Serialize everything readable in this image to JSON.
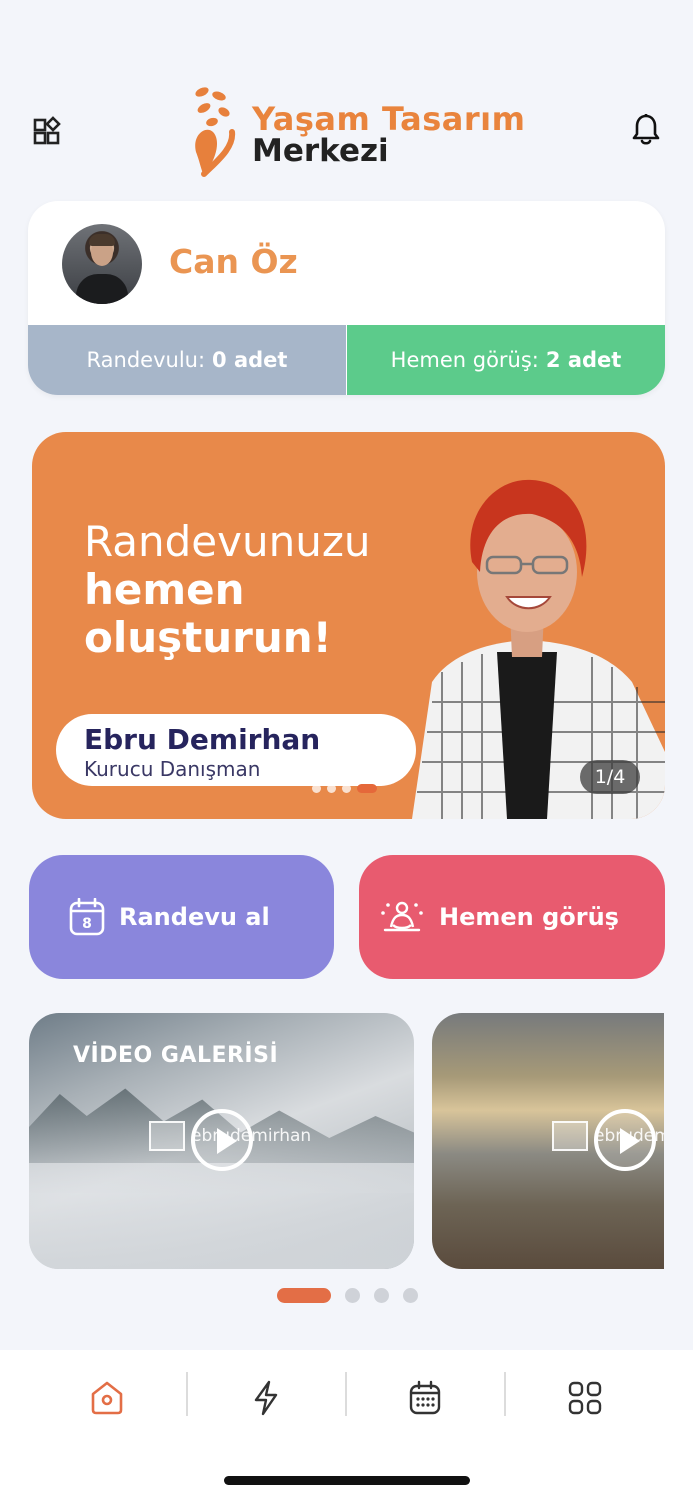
{
  "header": {
    "brand_line1": "Yaşam Tasarım",
    "brand_line2": "Merkezi",
    "menu_icon": "grid-menu-icon",
    "notification_icon": "bell-icon"
  },
  "profile": {
    "name": "Can Öz",
    "stats": {
      "appointment_label": "Randevulu:",
      "appointment_value": "0 adet",
      "instant_label": "Hemen görüş:",
      "instant_value": "2 adet"
    }
  },
  "banner": {
    "title_light": "Randevunuzu",
    "title_bold_1": "hemen",
    "title_bold_2": "oluşturun!",
    "person_name": "Ebru Demirhan",
    "person_role": "Kurucu Danışman",
    "counter": "1/4",
    "dot_count": 4,
    "active_dot": 3
  },
  "actions": {
    "appointment_label": "Randevu al",
    "appointment_icon": "calendar-icon",
    "appointment_icon_text": "8",
    "instant_label": "Hemen görüş",
    "instant_icon": "meditation-icon"
  },
  "gallery": {
    "title": "VİDEO GALERİSİ",
    "watermark": "ebrudemirhan",
    "videos": [
      {
        "thumb": "misty-forest"
      },
      {
        "thumb": "sunset-mountain"
      }
    ],
    "dot_count": 4,
    "active_dot": 0
  },
  "colors": {
    "brand_orange": "#e9843d",
    "appointment_gray": "#a7b6c9",
    "instant_green": "#5ccb8b",
    "button_purple": "#8a86dc",
    "button_red": "#e85b6f",
    "nav_active": "#e36e46"
  },
  "bottom_nav": {
    "items": [
      {
        "icon": "home-icon",
        "active": true
      },
      {
        "icon": "lightning-icon",
        "active": false
      },
      {
        "icon": "calendar-icon",
        "active": false
      },
      {
        "icon": "apps-grid-icon",
        "active": false
      }
    ]
  }
}
